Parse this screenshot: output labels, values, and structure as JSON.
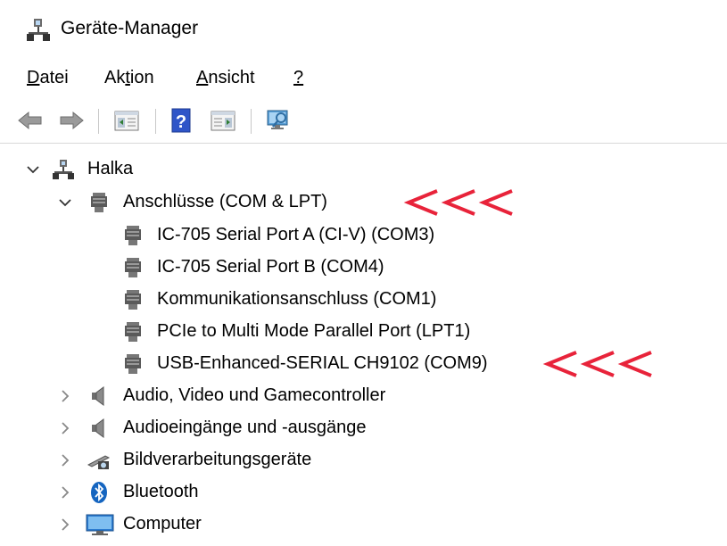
{
  "window": {
    "title": "Geräte-Manager"
  },
  "menu": [
    {
      "prefix": "",
      "underline": "D",
      "suffix": "atei"
    },
    {
      "prefix": "Ak",
      "underline": "t",
      "suffix": "ion"
    },
    {
      "prefix": "",
      "underline": "A",
      "suffix": "nsicht"
    },
    {
      "prefix": "",
      "underline": "?",
      "suffix": ""
    }
  ],
  "toolbar": {
    "buttons": [
      "back-icon",
      "forward-icon",
      "properties-icon",
      "help-icon",
      "view-icon",
      "scan-hardware-icon"
    ]
  },
  "tree": {
    "root": {
      "label": "Halka",
      "expanded": true
    },
    "ports": {
      "label": "Anschlüsse (COM & LPT)",
      "expanded": true,
      "children": [
        "IC-705 Serial Port A (CI-V) (COM3)",
        "IC-705 Serial Port B (COM4)",
        "Kommunikationsanschluss (COM1)",
        "PCIe to Multi Mode Parallel Port (LPT1)",
        "USB-Enhanced-SERIAL CH9102 (COM9)"
      ]
    },
    "categories": [
      {
        "label": "Audio, Video und Gamecontroller",
        "icon": "speaker-icon"
      },
      {
        "label": "Audioeingänge und -ausgänge",
        "icon": "speaker-icon"
      },
      {
        "label": "Bildverarbeitungsgeräte",
        "icon": "camera-icon"
      },
      {
        "label": "Bluetooth",
        "icon": "bluetooth-icon"
      },
      {
        "label": "Computer",
        "icon": "monitor-icon"
      }
    ]
  },
  "annotations": {
    "arrow_color": "#e8233a",
    "arrow_text": "<<<"
  },
  "colors": {
    "accent": "#1e6fd0",
    "bluetooth": "#1565c0"
  }
}
